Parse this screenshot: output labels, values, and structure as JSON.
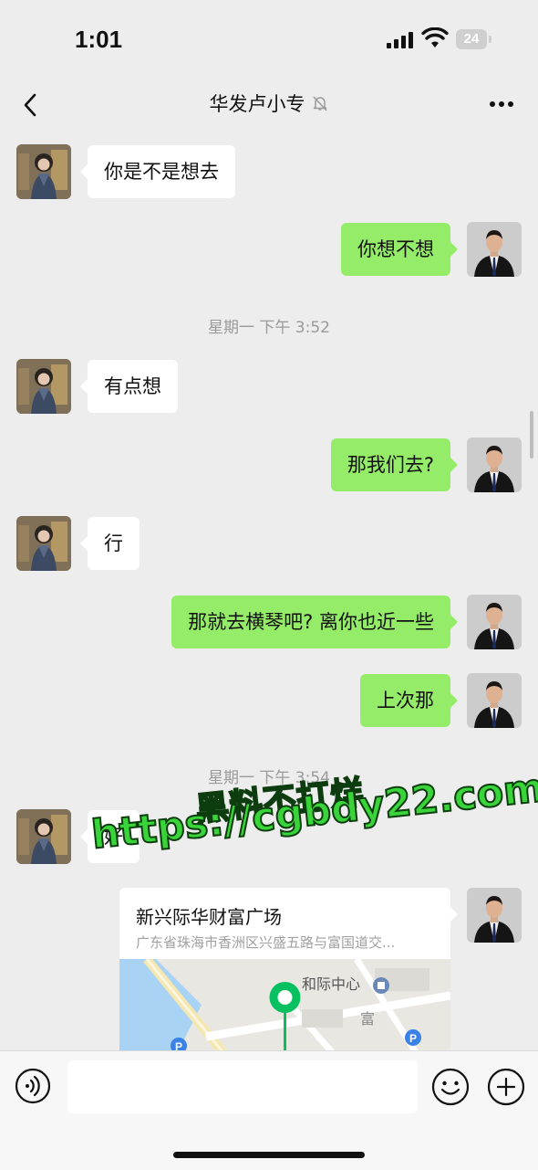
{
  "status_bar": {
    "time": "1:01",
    "battery": "24"
  },
  "nav": {
    "title": "华发卢小专"
  },
  "messages": [
    {
      "side": "in",
      "text": "你是不是想去"
    },
    {
      "side": "out",
      "text": "你想不想"
    },
    {
      "side": "in",
      "text": "有点想"
    },
    {
      "side": "out",
      "text": "那我们去?"
    },
    {
      "side": "in",
      "text": "行"
    },
    {
      "side": "out",
      "text": "那就去横琴吧?  离你也近一些"
    },
    {
      "side": "out",
      "text": "上次那"
    },
    {
      "side": "in",
      "text": "好"
    }
  ],
  "timestamps": [
    "星期一 下午 3:52",
    "星期一 下午 3:54"
  ],
  "location": {
    "name": "新兴际华财富广场",
    "address": "广东省珠海市香洲区兴盛五路与富国道交...",
    "map_label": "和际中心",
    "map_street_char": "富"
  },
  "watermark": {
    "line1": "黑料不打烊",
    "line2": "https://cgbdy22.com"
  },
  "colors": {
    "outgoing_bubble": "#95ec69",
    "incoming_bubble": "#ffffff",
    "background": "#ededed",
    "pin": "#07c160"
  }
}
